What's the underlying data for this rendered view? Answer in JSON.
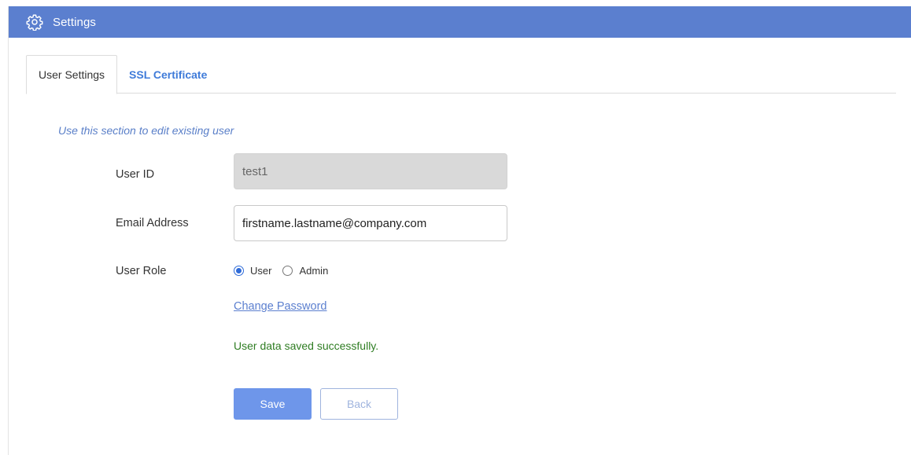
{
  "header": {
    "title": "Settings",
    "icon": "gear-icon",
    "color": "#5b7fcf"
  },
  "tabs": [
    {
      "label": "User Settings",
      "active": true
    },
    {
      "label": "SSL Certificate",
      "active": false
    }
  ],
  "form": {
    "hint": "Use this section to edit existing user",
    "user_id": {
      "label": "User ID",
      "value": "test1"
    },
    "email": {
      "label": "Email Address",
      "value": "firstname.lastname@company.com"
    },
    "role": {
      "label": "User Role",
      "options": [
        {
          "label": "User",
          "checked": true
        },
        {
          "label": "Admin",
          "checked": false
        }
      ]
    },
    "change_password_link": "Change Password",
    "status_message": "User data saved successfully.",
    "status_color": "#2f7d23"
  },
  "buttons": {
    "save": "Save",
    "back": "Back"
  },
  "colors": {
    "accent": "#6e96ea",
    "link": "#5b7fcf"
  }
}
